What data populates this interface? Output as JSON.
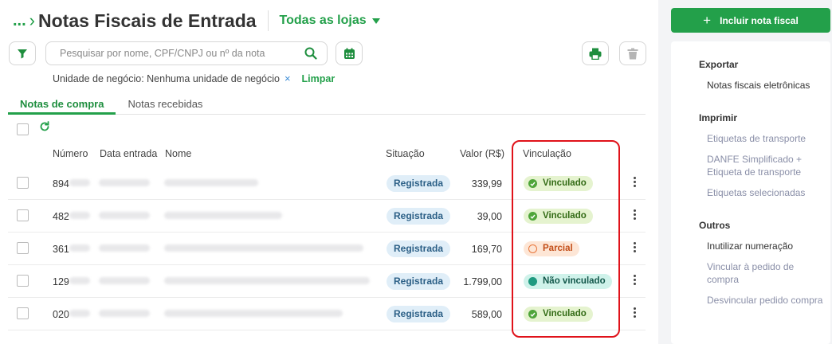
{
  "header": {
    "breadcrumb": "...",
    "title": "Notas Fiscais de Entrada",
    "store_selector": "Todas as lojas"
  },
  "search": {
    "placeholder": "Pesquisar por nome, CPF/CNPJ ou nº da nota"
  },
  "filters": {
    "chip_text": "Unidade de negócio: Nenhuma unidade de negócio",
    "chip_remove": "×",
    "clear_label": "Limpar"
  },
  "tabs": [
    {
      "label": "Notas de compra",
      "active": true
    },
    {
      "label": "Notas recebidas",
      "active": false
    }
  ],
  "table": {
    "columns": {
      "number": "Número",
      "date": "Data entrada",
      "name": "Nome",
      "status": "Situação",
      "value": "Valor (R$)",
      "link": "Vinculação"
    },
    "rows": [
      {
        "number": "894",
        "status": "Registrada",
        "value": "339,99",
        "link": "Vinculado",
        "link_state": "green"
      },
      {
        "number": "482",
        "status": "Registrada",
        "value": "39,00",
        "link": "Vinculado",
        "link_state": "green"
      },
      {
        "number": "361",
        "status": "Registrada",
        "value": "169,70",
        "link": "Parcial",
        "link_state": "orange"
      },
      {
        "number": "129",
        "status": "Registrada",
        "value": "1.799,00",
        "link": "Não vinculado",
        "link_state": "teal"
      },
      {
        "number": "020",
        "status": "Registrada",
        "value": "589,00",
        "link": "Vinculado",
        "link_state": "green"
      }
    ]
  },
  "sidebar": {
    "add_button": "Incluir nota fiscal",
    "export": {
      "title": "Exportar",
      "items": [
        "Notas fiscais eletrônicas"
      ]
    },
    "print": {
      "title": "Imprimir",
      "items": [
        "Etiquetas de transporte",
        "DANFE Simplificado + Etiqueta de transporte",
        "Etiquetas selecionadas"
      ]
    },
    "others": {
      "title": "Outros",
      "items": [
        "Inutilizar numeração",
        "Vincular à pedido de compra",
        "Desvincular pedido compra"
      ]
    }
  },
  "colors": {
    "brand_green": "#23a04a",
    "highlight_red": "#e0121a"
  }
}
